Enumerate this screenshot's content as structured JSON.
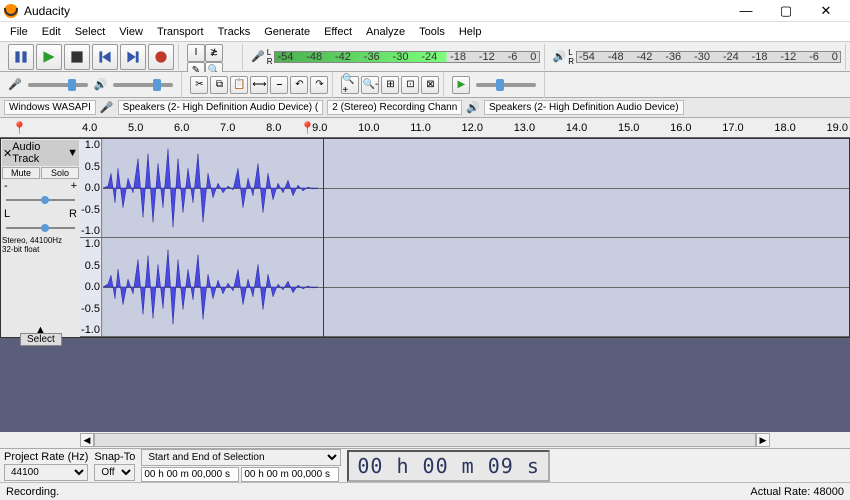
{
  "app": {
    "title": "Audacity"
  },
  "menu": [
    "File",
    "Edit",
    "Select",
    "View",
    "Transport",
    "Tracks",
    "Generate",
    "Effect",
    "Analyze",
    "Tools",
    "Help"
  ],
  "transport": {
    "pause": "pause-icon",
    "play": "play-icon",
    "stop": "stop-icon",
    "skip_start": "skip-start-icon",
    "skip_end": "skip-end-icon",
    "record": "record-icon"
  },
  "tools": [
    "selection-tool",
    "envelope-tool",
    "draw-tool",
    "zoom-tool",
    "timeshift-tool",
    "multi-tool"
  ],
  "rec_meter": {
    "ticks": [
      "-54",
      "-48",
      "-42",
      "-36",
      "-30",
      "",
      "-24",
      "",
      "-18",
      "",
      "-12",
      "",
      "-6",
      "",
      "0"
    ]
  },
  "play_meter": {
    "ticks": [
      "-54",
      "-48",
      "-42",
      "-36",
      "-30",
      "-24",
      "-18",
      "-12",
      "-6",
      "0"
    ]
  },
  "device": {
    "host": "Windows WASAPI",
    "rec_device": "Speakers (2- High Definition Audio Device) (",
    "channels": "2 (Stereo) Recording Chann",
    "play_device": "Speakers (2- High Definition Audio Device)"
  },
  "edit_icons": [
    "cut-icon",
    "copy-icon",
    "paste-icon",
    "trim-icon",
    "silence-icon",
    "undo-icon",
    "redo-icon"
  ],
  "zoom_icons": [
    "zoom-in-icon",
    "zoom-out-icon",
    "fit-selection-icon",
    "fit-project-icon",
    "zoom-toggle-icon"
  ],
  "play_at_speed": "play-at-speed-icon",
  "timeline": {
    "ticks": [
      "4.0",
      "5.0",
      "6.0",
      "7.0",
      "8.0",
      "9.0",
      "10.0",
      "11.0",
      "12.0",
      "13.0",
      "14.0",
      "15.0",
      "16.0",
      "17.0",
      "18.0",
      "19.0"
    ]
  },
  "track": {
    "name": "Audio Track",
    "mute": "Mute",
    "solo": "Solo",
    "pan_left": "L",
    "pan_right": "R",
    "format": "Stereo, 44100Hz\n32-bit float",
    "scale": [
      "1.0",
      "0.5",
      "0.0",
      "-0.5",
      "-1.0"
    ]
  },
  "select_button": "Select",
  "bottom": {
    "project_rate_label": "Project Rate (Hz)",
    "project_rate": "44100",
    "snap_label": "Snap-To",
    "snap": "Off",
    "selection_label": "Start and End of Selection",
    "sel_start": "00 h 00 m 00,000 s",
    "sel_end": "00 h 00 m 00,000 s",
    "time_display": "00 h 00 m 09 s"
  },
  "status": {
    "left": "Recording.",
    "right": "Actual Rate: 48000"
  }
}
